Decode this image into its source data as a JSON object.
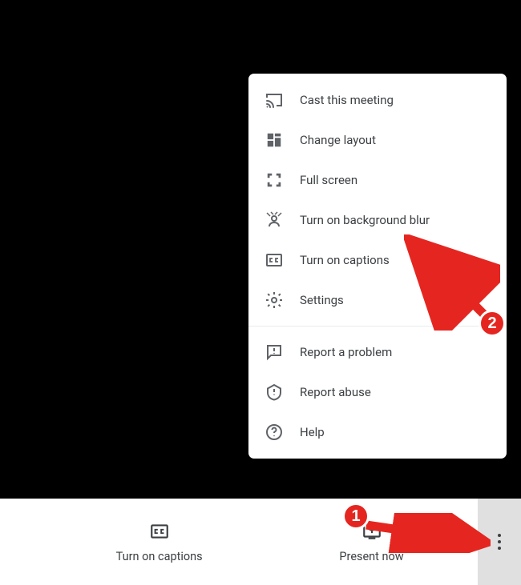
{
  "menu": {
    "items": [
      {
        "label": "Cast this meeting",
        "icon": "cast-icon"
      },
      {
        "label": "Change layout",
        "icon": "layout-icon"
      },
      {
        "label": "Full screen",
        "icon": "fullscreen-icon"
      },
      {
        "label": "Turn on background blur",
        "icon": "person-blur-icon"
      },
      {
        "label": "Turn on captions",
        "icon": "captions-icon"
      },
      {
        "label": "Settings",
        "icon": "gear-icon"
      }
    ],
    "items2": [
      {
        "label": "Report a problem",
        "icon": "feedback-icon"
      },
      {
        "label": "Report abuse",
        "icon": "report-abuse-icon"
      },
      {
        "label": "Help",
        "icon": "help-icon"
      }
    ]
  },
  "bottom": {
    "captions_label": "Turn on captions",
    "present_label": "Present now"
  },
  "callouts": {
    "one": "1",
    "two": "2"
  }
}
